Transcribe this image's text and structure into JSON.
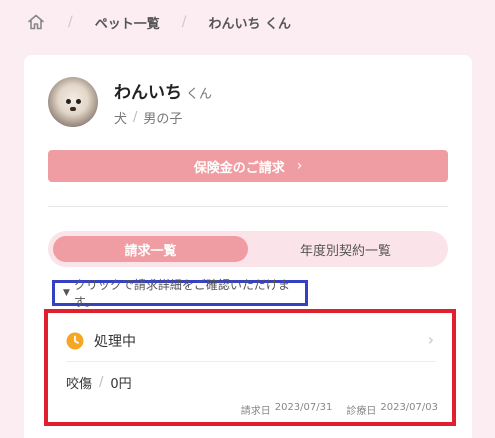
{
  "breadcrumb": {
    "home_icon": "home-icon",
    "items": [
      "ペット一覧",
      "わんいち くん"
    ],
    "separator": "/"
  },
  "pet": {
    "name": "わんいち",
    "suffix": "くん",
    "species": "犬",
    "gender": "男の子",
    "separator": "/"
  },
  "claim_button": {
    "label": "保険金のご請求",
    "chevron": "›"
  },
  "tabs": [
    {
      "label": "請求一覧",
      "active": true
    },
    {
      "label": "年度別契約一覧",
      "active": false
    }
  ],
  "hint": {
    "marker": "▼",
    "text": "クリックで請求詳細をご確認いただけます。"
  },
  "claims": [
    {
      "status": "処理中",
      "status_icon": "clock-icon",
      "diagnosis": "咬傷",
      "amount": "0円",
      "claim_date_label": "請求日",
      "claim_date": "2023/07/31",
      "visit_date_label": "診療日",
      "visit_date": "2023/07/03",
      "chevron": "›"
    }
  ],
  "colors": {
    "background": "#fcedf2",
    "accent": "#ef9da2",
    "status_icon": "#f5a623",
    "hint_outline": "#3540c4",
    "claim_outline": "#e0202f"
  }
}
